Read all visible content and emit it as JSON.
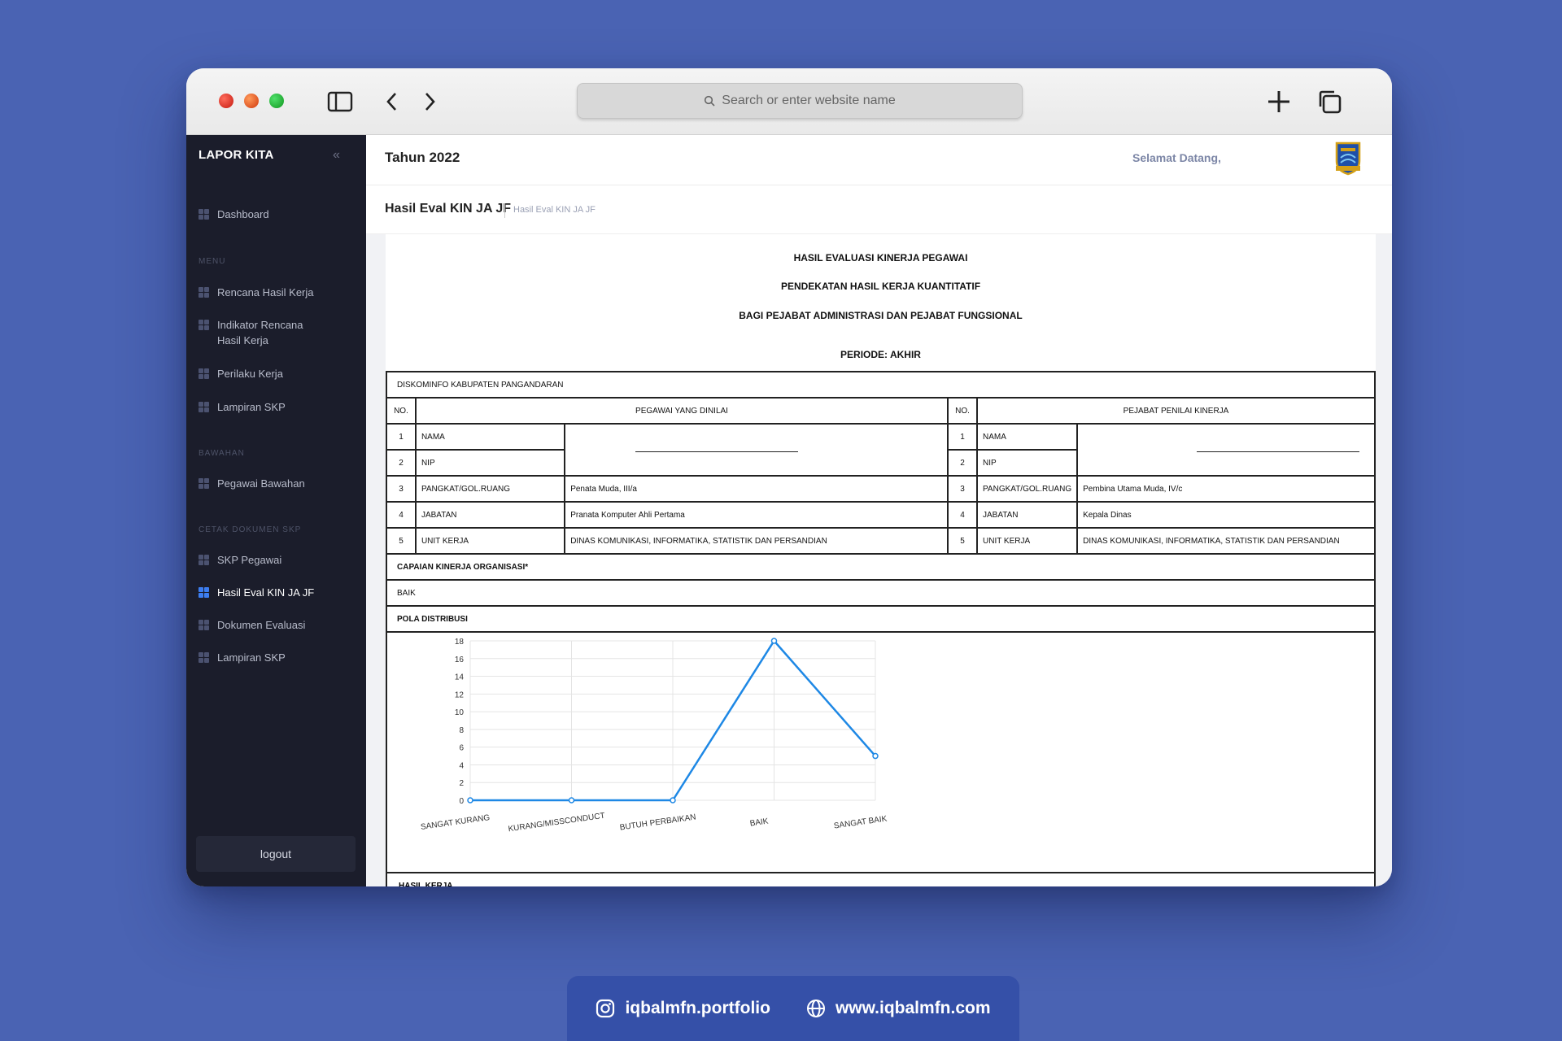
{
  "browser": {
    "address_placeholder": "Search or enter website name"
  },
  "sidebar": {
    "brand": "LAPOR KITA",
    "collapse_glyph": "«",
    "dashboard": "Dashboard",
    "section_menu": "MENU",
    "menu": [
      "Rencana Hasil Kerja",
      "Indikator Rencana Hasil Kerja",
      "Perilaku Kerja",
      "Lampiran SKP"
    ],
    "section_bawahan": "BAWAHAN",
    "bawahan": [
      "Pegawai Bawahan"
    ],
    "section_cetak": "CETAK DOKUMEN SKP",
    "cetak": [
      "SKP Pegawai",
      "Hasil Eval KIN JA JF",
      "Dokumen Evaluasi",
      "Lampiran SKP"
    ],
    "logout": "logout"
  },
  "topbar": {
    "year": "Tahun 2022",
    "welcome": "Selamat Datang,"
  },
  "page": {
    "title": "Hasil Eval KIN JA JF",
    "breadcrumb": "Hasil Eval KIN JA JF"
  },
  "doc": {
    "title1": "HASIL EVALUASI KINERJA PEGAWAI",
    "title2": "PENDEKATAN HASIL KERJA KUANTITATIF",
    "title3": "BAGI PEJABAT ADMINISTRASI DAN PEJABAT FUNGSIONAL",
    "periode": "PERIODE: AKHIR",
    "org": "DISKOMINFO KABUPATEN PANGANDARAN",
    "col_no": "NO.",
    "col_pegawai": "PEGAWAI YANG DINILAI",
    "col_pejabat": "PEJABAT PENILAI KINERJA",
    "rows": [
      {
        "no": "1",
        "label": "NAMA",
        "left_value": "",
        "right_value": ""
      },
      {
        "no": "2",
        "label": "NIP",
        "left_value": "",
        "right_value": ""
      },
      {
        "no": "3",
        "label": "PANGKAT/GOL.RUANG",
        "left_value": "Penata Muda, III/a",
        "right_value": "Pembina Utama Muda, IV/c"
      },
      {
        "no": "4",
        "label": "JABATAN",
        "left_value": "Pranata Komputer Ahli Pertama",
        "right_value": "Kepala Dinas"
      },
      {
        "no": "5",
        "label": "UNIT KERJA",
        "left_value": "DINAS KOMUNIKASI, INFORMATIKA, STATISTIK DAN PERSANDIAN",
        "right_value": "DINAS KOMUNIKASI, INFORMATIKA, STATISTIK DAN PERSANDIAN"
      }
    ],
    "capaian_label": "CAPAIAN KINERJA ORGANISASI*",
    "capaian_value": "BAIK",
    "pola_label": "POLA DISTRIBUSI",
    "hasil_label": "HASIL KERJA"
  },
  "chart_data": {
    "type": "line",
    "categories": [
      "SANGAT KURANG",
      "KURANG/MISSCONDUCT",
      "BUTUH PERBAIKAN",
      "BAIK",
      "SANGAT BAIK"
    ],
    "values": [
      0,
      0,
      0,
      18,
      5
    ],
    "ylim": [
      0,
      18
    ],
    "yticks": [
      0,
      2,
      4,
      6,
      8,
      10,
      12,
      14,
      16,
      18
    ],
    "grid": true,
    "line_color": "#1e88e5"
  },
  "footer": {
    "instagram": "iqbalmfn.portfolio",
    "website": "www.iqbalmfn.com"
  },
  "colors": {
    "background": "#4a63b3",
    "sidebar": "#1b1d2b",
    "active": "#3c7df0"
  }
}
